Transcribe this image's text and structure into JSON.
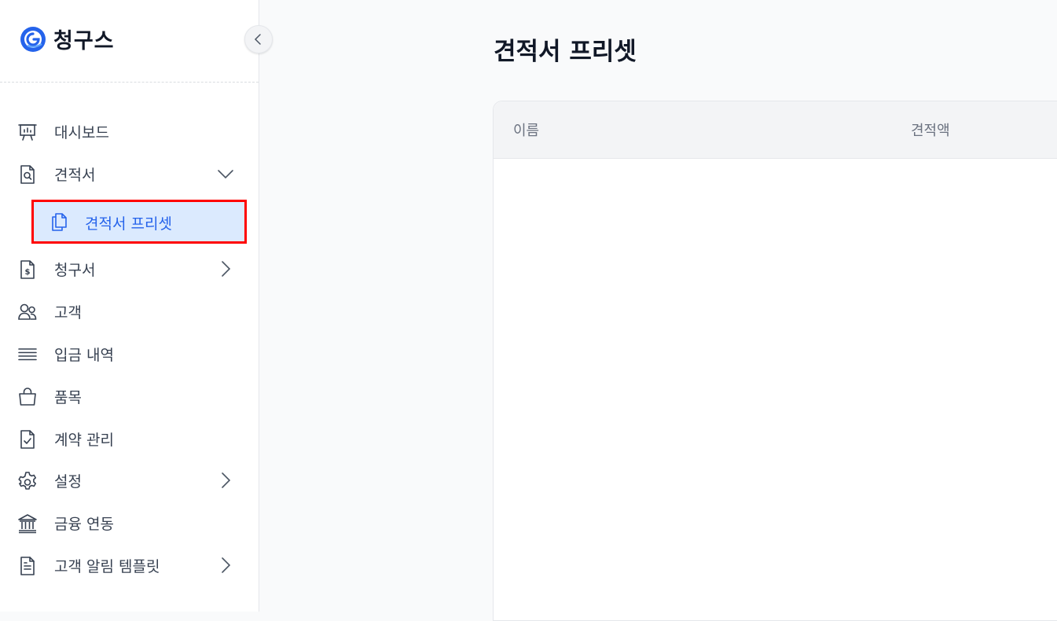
{
  "app": {
    "name": "청구스",
    "logo_icon": "chungus-logo-icon"
  },
  "colors": {
    "accent": "#2563eb",
    "active_bg": "#dbeafe",
    "highlight_border": "#ff0000"
  },
  "sidebar": {
    "collapse_icon": "chevron-left-icon",
    "items": [
      {
        "label": "대시보드",
        "icon": "presentation-board-icon"
      },
      {
        "label": "견적서",
        "icon": "document-search-icon",
        "expanded": true,
        "children": [
          {
            "label": "견적서 프리셋",
            "icon": "copy-documents-icon",
            "active": true
          }
        ]
      },
      {
        "label": "청구서",
        "icon": "document-dollar-icon"
      },
      {
        "label": "고객",
        "icon": "users-icon"
      },
      {
        "label": "입금 내역",
        "icon": "list-lines-icon"
      },
      {
        "label": "품목",
        "icon": "shopping-bag-icon"
      },
      {
        "label": "계약 관리",
        "icon": "document-check-icon"
      },
      {
        "label": "설정",
        "icon": "gear-icon"
      },
      {
        "label": "금융 연동",
        "icon": "bank-icon"
      },
      {
        "label": "고객 알림 템플릿",
        "icon": "document-text-icon"
      }
    ]
  },
  "main": {
    "title": "견적서 프리셋",
    "table": {
      "columns": [
        "이름",
        "견적액"
      ],
      "rows": []
    }
  }
}
